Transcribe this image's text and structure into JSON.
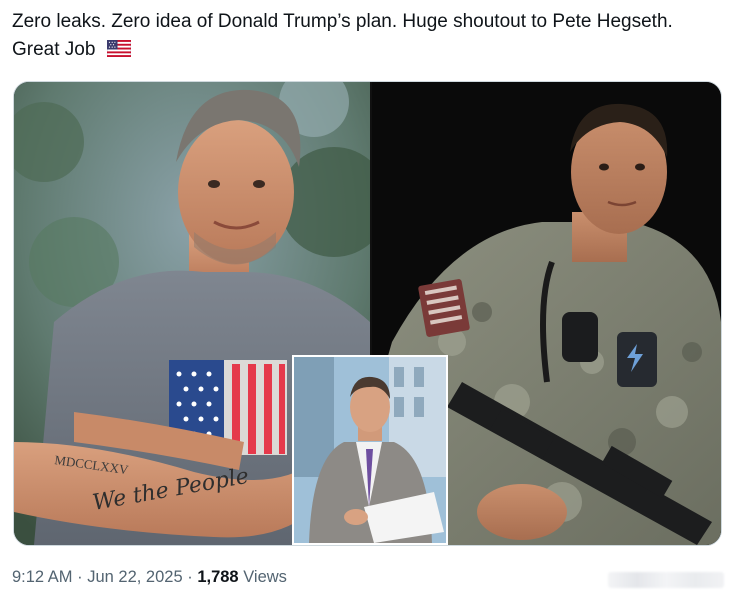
{
  "tweet": {
    "text": "Zero leaks. Zero idea of Donald Trump’s plan. Huge shoutout to Pete Hegseth. Great Job",
    "emoji": "us-flag-icon"
  },
  "media": {
    "left_photo": "man in gray t-shirt with US flag design, arms crossed, tattoos on forearm",
    "tattoo_upper": "MDCCLXXV",
    "tattoo_lower": "We the People",
    "right_photo": "soldier in camouflage uniform holding rifle at night",
    "inset_photo": "man in gray suit and purple tie seated in TV studio"
  },
  "meta": {
    "time": "9:12 AM",
    "sep1": " · ",
    "date": "Jun 22, 2025",
    "sep2": " · ",
    "views_count": "1,788",
    "views_label": " Views"
  },
  "colors": {
    "text": "#0f1419",
    "secondary": "#536471",
    "border": "#cfd9de"
  }
}
